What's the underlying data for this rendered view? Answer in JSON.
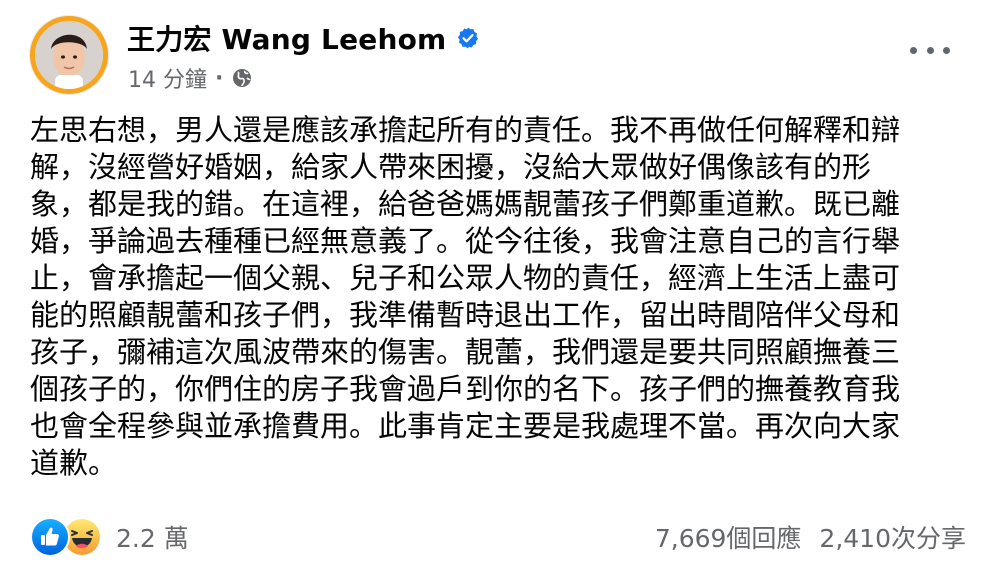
{
  "author": {
    "name": "王力宏 Wang Leehom",
    "verified_icon": "verified-badge-icon",
    "avatar_ring_color": "#f7a51c"
  },
  "meta": {
    "time": "14 分鐘",
    "separator": "·",
    "audience_icon": "globe-icon"
  },
  "menu": {
    "icon": "more-horizontal-icon"
  },
  "post": {
    "lines": [
      "左思右想，男人還是應該承擔起所有的責任。我不再做任何解釋和辯",
      "解，沒經營好婚姻，給家人帶來困擾，沒給大眾做好偶像該有的形",
      "象，都是我的錯。在這裡，給爸爸媽媽靚蕾孩子們鄭重道歉。既已離",
      "婚，爭論過去種種已經無意義了。從今往後，我會注意自己的言行舉",
      "止，會承擔起一個父親、兒子和公眾人物的責任，經濟上生活上盡可",
      "能的照顧靚蕾和孩子們，我準備暫時退出工作，留出時間陪伴父母和",
      "孩子，彌補這次風波帶來的傷害。靚蕾，我們還是要共同照顧撫養三",
      "個孩子的，你們住的房子我會過戶到你的名下。孩子們的撫養教育我",
      "也會全程參與並承擔費用。此事肯定主要是我處理不當。再次向大家",
      "道歉。"
    ]
  },
  "footer": {
    "reaction_icons": [
      "like-icon",
      "haha-icon"
    ],
    "reaction_count": "2.2 萬",
    "comments": "7,669個回應",
    "shares": "2,410次分享"
  },
  "colors": {
    "facebook_blue": "#1877f2",
    "secondary_text": "#65676b",
    "haha_yellow": "#f7b125"
  }
}
